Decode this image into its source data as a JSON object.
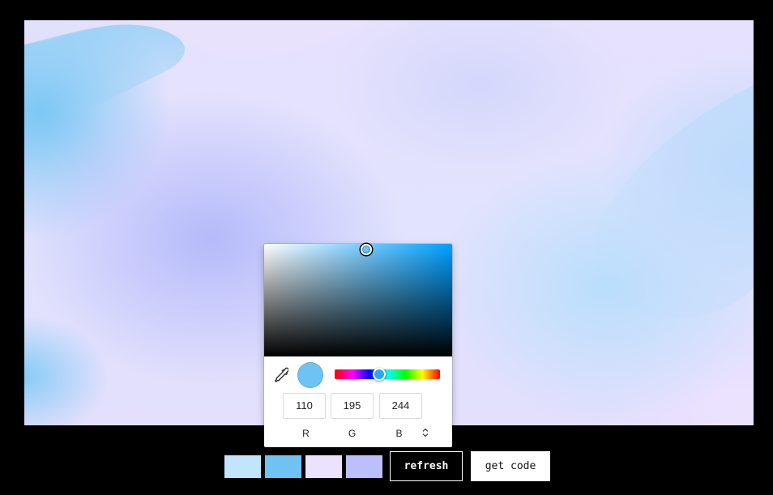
{
  "picker": {
    "current_color": "#6ec3f4",
    "hue_color": "#00a0ff",
    "mode": "RGB",
    "r": "110",
    "g": "195",
    "b": "244",
    "r_label": "R",
    "g_label": "G",
    "b_label": "B"
  },
  "swatches": [
    {
      "color": "#c1e5fd"
    },
    {
      "color": "#6ec3f4"
    },
    {
      "color": "#eae2fe"
    },
    {
      "color": "#bbbffc"
    }
  ],
  "actions": {
    "refresh_label": "refresh",
    "code_label": "get code"
  },
  "icons": {
    "eyedropper": "eyedropper-icon",
    "mode_toggle": "chevron-up-down-icon"
  }
}
